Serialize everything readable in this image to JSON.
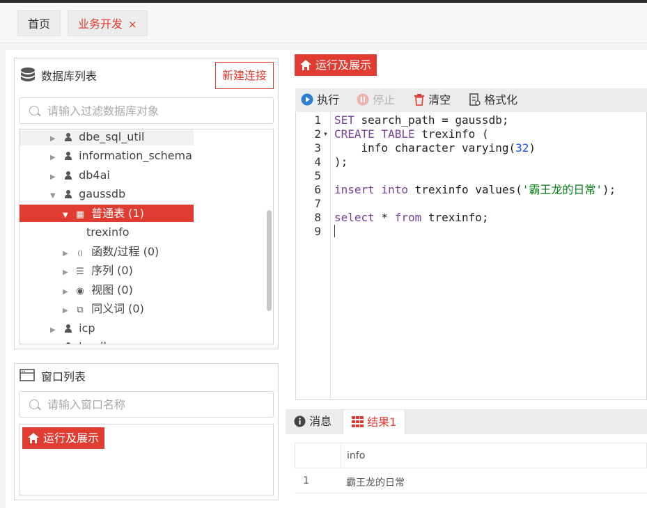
{
  "tabs": {
    "home": "首页",
    "active": "业务开发",
    "close": "×"
  },
  "db_panel": {
    "title": "数据库列表",
    "new_conn": "新建连接",
    "filter_placeholder": "请输入过滤数据库对象",
    "tree": [
      {
        "label": "dbe_sql_util",
        "icon": "user-icon"
      },
      {
        "label": "information_schema",
        "icon": "user-icon"
      },
      {
        "label": "db4ai",
        "icon": "user-icon"
      },
      {
        "label": "gaussdb",
        "icon": "user-icon"
      },
      {
        "label": "普通表 (1)",
        "icon": "table-icon"
      },
      {
        "label": "trexinfo",
        "icon": ""
      },
      {
        "label": "函数/过程 (0)",
        "icon": "code-file-icon"
      },
      {
        "label": "序列 (0)",
        "icon": "list-icon"
      },
      {
        "label": "视图 (0)",
        "icon": "eye-icon"
      },
      {
        "label": "同义词 (0)",
        "icon": "synonym-icon"
      },
      {
        "label": "icp",
        "icon": "user-icon"
      },
      {
        "label": "tcpdh",
        "icon": "user-icon"
      }
    ]
  },
  "win_panel": {
    "title": "窗口列表",
    "filter_placeholder": "请输入窗口名称",
    "items": [
      "运行及展示"
    ]
  },
  "right": {
    "title": "运行及展示",
    "toolbar": {
      "run": "执行",
      "stop": "停止",
      "clear": "清空",
      "format": "格式化"
    },
    "editor": {
      "line_numbers": [
        "1",
        "2",
        "3",
        "4",
        "5",
        "6",
        "7",
        "8",
        "9"
      ],
      "lines": [
        "SET search_path = gaussdb;",
        "CREATE TABLE trexinfo (",
        "    info character varying(32)",
        ");",
        "",
        "insert into trexinfo values('霸王龙的日常');",
        "",
        "select * from trexinfo;",
        ""
      ]
    },
    "result_tabs": {
      "messages": "消息",
      "result": "结果1"
    },
    "result": {
      "columns": [
        "info"
      ],
      "rows": [
        [
          "1",
          "霸王龙的日常"
        ]
      ]
    }
  },
  "colors": {
    "accent": "#e03c31",
    "run_blue": "#2a7fd4"
  }
}
